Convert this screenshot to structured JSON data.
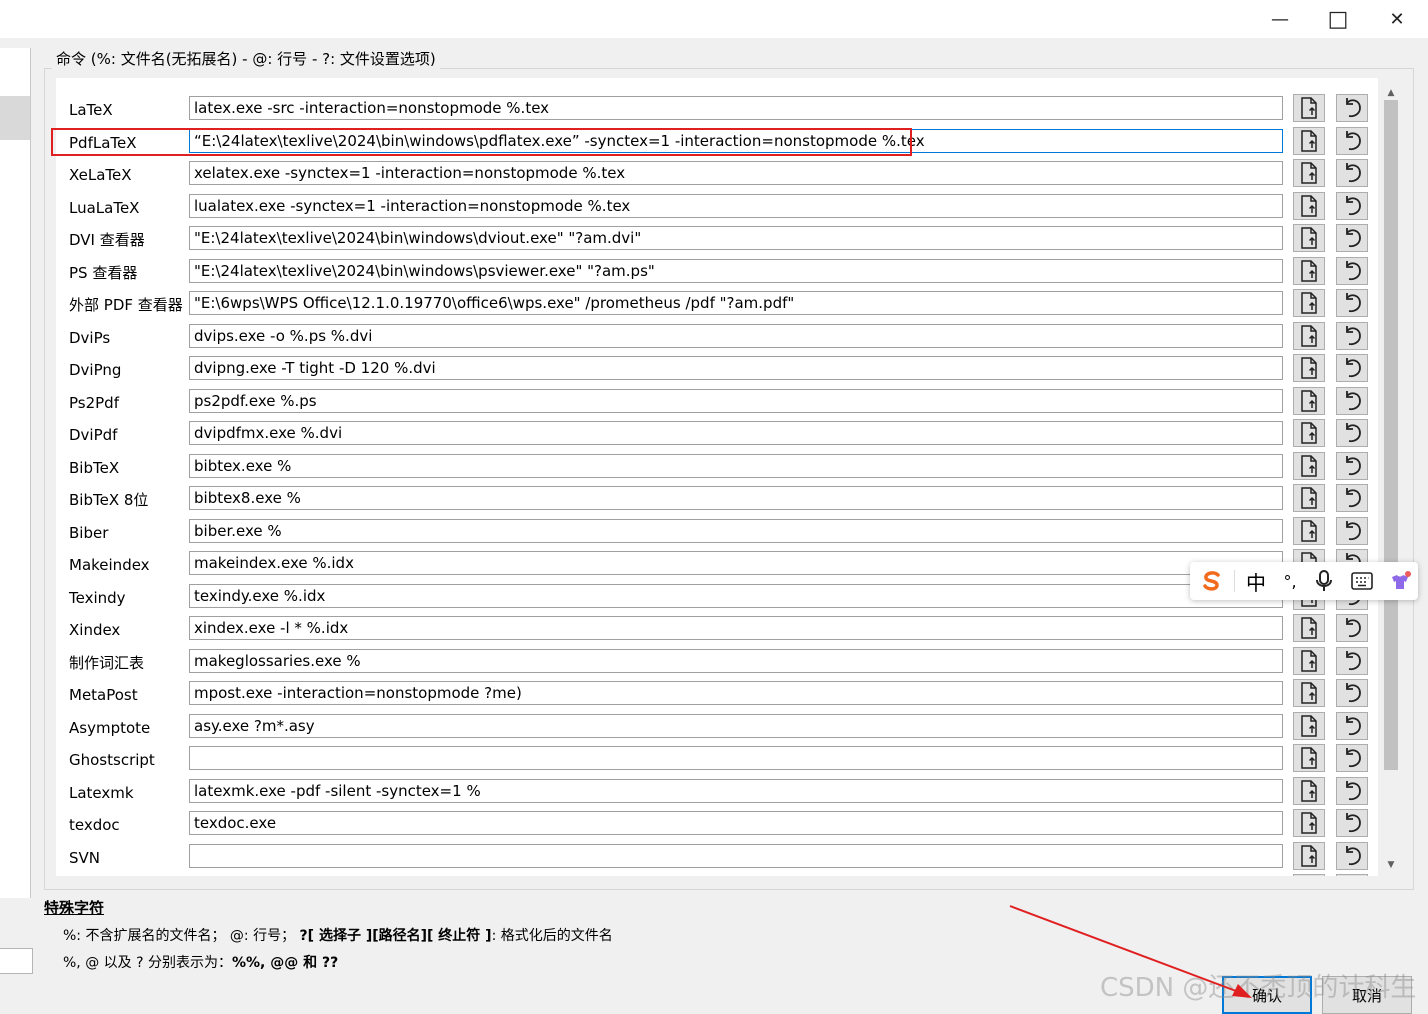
{
  "window": {
    "minimize": "—",
    "maximize": "□",
    "close": "✕"
  },
  "group_label": "命令 (%: 文件名(无拓展名) - @: 行号 - ?: 文件设置选项)",
  "commands": [
    {
      "label": "LaTeX",
      "value": "latex.exe -src -interaction=nonstopmode %.tex"
    },
    {
      "label": "PdfLaTeX",
      "value": "“E:\\24latex\\texlive\\2024\\bin\\windows\\pdflatex.exe” -synctex=1 -interaction=nonstopmode %.tex"
    },
    {
      "label": "XeLaTeX",
      "value": "xelatex.exe -synctex=1 -interaction=nonstopmode %.tex"
    },
    {
      "label": "LuaLaTeX",
      "value": "lualatex.exe -synctex=1 -interaction=nonstopmode %.tex"
    },
    {
      "label": "DVI 查看器",
      "value": "\"E:\\24latex\\texlive\\2024\\bin\\windows\\dviout.exe\" \"?am.dvi\""
    },
    {
      "label": "PS 查看器",
      "value": "\"E:\\24latex\\texlive\\2024\\bin\\windows\\psviewer.exe\" \"?am.ps\""
    },
    {
      "label": "外部 PDF 查看器",
      "value": "\"E:\\6wps\\WPS Office\\12.1.0.19770\\office6\\wps.exe\" /prometheus /pdf \"?am.pdf\""
    },
    {
      "label": "DviPs",
      "value": "dvips.exe -o %.ps %.dvi"
    },
    {
      "label": "DviPng",
      "value": "dvipng.exe -T tight -D 120 %.dvi"
    },
    {
      "label": "Ps2Pdf",
      "value": "ps2pdf.exe %.ps"
    },
    {
      "label": "DviPdf",
      "value": "dvipdfmx.exe %.dvi"
    },
    {
      "label": "BibTeX",
      "value": "bibtex.exe %"
    },
    {
      "label": "BibTeX 8位",
      "value": "bibtex8.exe %"
    },
    {
      "label": "Biber",
      "value": "biber.exe %"
    },
    {
      "label": "Makeindex",
      "value": "makeindex.exe %.idx"
    },
    {
      "label": "Texindy",
      "value": "texindy.exe %.idx"
    },
    {
      "label": "Xindex",
      "value": "xindex.exe -l * %.idx"
    },
    {
      "label": "制作词汇表",
      "value": "makeglossaries.exe %"
    },
    {
      "label": "MetaPost",
      "value": "mpost.exe -interaction=nonstopmode ?me)"
    },
    {
      "label": "Asymptote",
      "value": "asy.exe ?m*.asy"
    },
    {
      "label": "Ghostscript",
      "value": ""
    },
    {
      "label": "Latexmk",
      "value": "latexmk.exe -pdf -silent -synctex=1 %"
    },
    {
      "label": "texdoc",
      "value": "texdoc.exe"
    },
    {
      "label": "SVN",
      "value": ""
    },
    {
      "label": "",
      "value": ""
    }
  ],
  "special": {
    "title": "特殊字符",
    "line1_a": "%: 不含扩展名的文件名；  @: 行号；  ",
    "line1_b": "?[ 选择子 ][路径名][ 终止符 ]",
    "line1_c": ": 格式化后的文件名",
    "line2_a": "%, @ 以及 ? 分别表示为：",
    "line2_b": "%%, @@ 和 ??"
  },
  "ime": {
    "chinese": "中",
    "punct": "°,"
  },
  "buttons": {
    "ok": "确认",
    "cancel": "取消"
  },
  "watermark": "CSDN @还不秃顶的计科生",
  "colors": {
    "highlight": "#e02020",
    "accent": "#0078d7"
  },
  "icons": {
    "row_button_1": "file-arrow-icon",
    "row_button_2": "undo-icon"
  }
}
